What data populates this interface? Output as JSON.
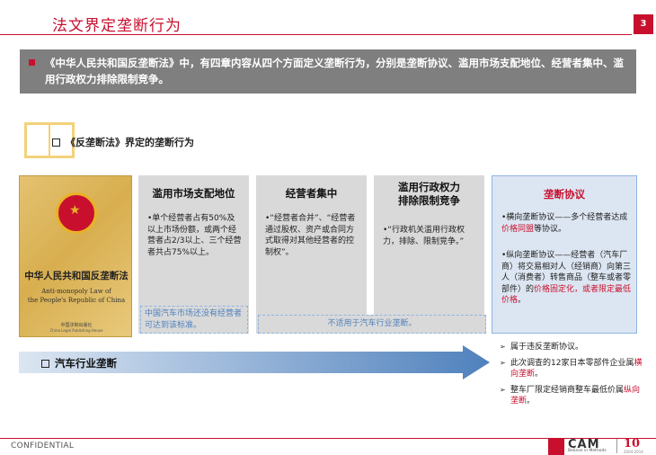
{
  "header": {
    "title": "法文界定垄断行为",
    "page_number": "3"
  },
  "summary": {
    "text": "《中华人民共和国反垄断法》中，有四章内容从四个方面定义垄断行为，分别是垄断协议、滥用市场支配地位、经营者集中、滥用行政权力排除限制竞争。"
  },
  "section": {
    "title": "《反垄断法》界定的垄断行为"
  },
  "cover": {
    "title_cn": "中华人民共和国反垄断法",
    "title_en_1": "Anti-monopoly Law of",
    "title_en_2": "the People's Republic of China",
    "publisher_cn": "中国法制出版社",
    "publisher_en": "China Legal Publishing House"
  },
  "columns": [
    {
      "title": "滥用市场支配地位",
      "body": "•单个经营者占有50%及以上市场份额，或两个经营者占2/3以上、三个经营者共占75%以上。"
    },
    {
      "title": "经营者集中",
      "body": "•“经营者合并”、“经营者通过股权、资产或合同方式取得对其他经营者的控制权”。"
    },
    {
      "title_line1": "滥用行政权力",
      "title_line2": "排除限制竞争",
      "body": "•“行政机关滥用行政权力，排除、限制竞争。”"
    },
    {
      "title": "垄断协议",
      "item1_prefix": "•横向垄断协议——多个经营者达成",
      "item1_highlight": "价格同盟",
      "item1_suffix": "等协议。",
      "item2_prefix": "•纵向垄断协议——经营者（汽车厂商）将交易相对人（经销商）向第三人（消费者）转售商品（整车或者零部件）的",
      "item2_highlight": "价格固定化，或者限定最低价格",
      "item2_suffix": "。"
    }
  ],
  "notes": {
    "note1": "中国汽车市场还没有经营者可达到该标准。",
    "note2": "不适用于汽车行业垄断。"
  },
  "arrow": {
    "label": "汽车行业垄断"
  },
  "findings": [
    {
      "prefix": "属于违反垄断协议。",
      "highlight": "",
      "suffix": ""
    },
    {
      "prefix": "此次调查的12家日本零部件企业属",
      "highlight": "横向垄断",
      "suffix": "。"
    },
    {
      "prefix": "整车厂限定经销商整车最低价属",
      "highlight": "纵向垄断",
      "suffix": "。"
    }
  ],
  "footer": {
    "confidential": "CONFIDENTIAL",
    "logo": "CAM",
    "logo_tagline": "Believe in Methods",
    "ten": "10",
    "years": "2004-2014"
  },
  "colors": {
    "accent": "#c8102e",
    "summary_bg": "#7f7f7f",
    "column_bg": "#d9d9d9",
    "highlight_col_bg": "#dce6f2",
    "note_text": "#4f81bd"
  }
}
